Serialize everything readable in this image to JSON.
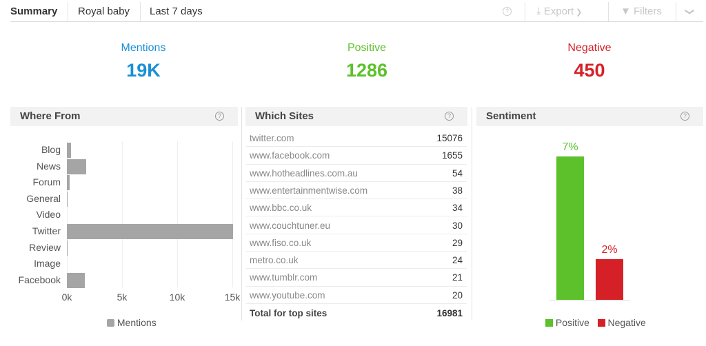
{
  "header": {
    "tabs": [
      "Summary",
      "Royal baby",
      "Last 7 days"
    ],
    "help_icon": "?",
    "export_label": "Export",
    "filters_label": "Filters"
  },
  "metrics": [
    {
      "label": "Mentions",
      "value": "19K",
      "color": "#1a8fd6"
    },
    {
      "label": "Positive",
      "value": "1286",
      "color": "#5cc12b"
    },
    {
      "label": "Negative",
      "value": "450",
      "color": "#d62027"
    }
  ],
  "panels": {
    "where_from": "Where From",
    "which_sites": "Which Sites",
    "sentiment": "Sentiment"
  },
  "chart_data": [
    {
      "type": "bar",
      "orientation": "horizontal",
      "categories": [
        "Blog",
        "News",
        "Forum",
        "General",
        "Video",
        "Twitter",
        "Review",
        "Image",
        "Facebook"
      ],
      "series": [
        {
          "name": "Mentions",
          "values": [
            370,
            1750,
            250,
            60,
            0,
            15076,
            10,
            0,
            1655
          ],
          "color": "#a5a5a5"
        }
      ],
      "xlim": [
        0,
        15000
      ],
      "xticks": [
        "0k",
        "5k",
        "10k",
        "15k"
      ],
      "grid": true,
      "legend": "bottom"
    },
    {
      "type": "bar",
      "categories": [
        "Positive",
        "Negative"
      ],
      "series": [
        {
          "name": "Positive",
          "values": [
            7
          ],
          "label": "7%",
          "color": "#5cc12b"
        },
        {
          "name": "Negative",
          "values": [
            2
          ],
          "label": "2%",
          "color": "#d62027"
        }
      ],
      "legend": "bottom"
    }
  ],
  "sites": {
    "rows": [
      {
        "site": "twitter.com",
        "count": "15076"
      },
      {
        "site": "www.facebook.com",
        "count": "1655"
      },
      {
        "site": "www.hotheadlines.com.au",
        "count": "54"
      },
      {
        "site": "www.entertainmentwise.com",
        "count": "38"
      },
      {
        "site": "www.bbc.co.uk",
        "count": "34"
      },
      {
        "site": "www.couchtuner.eu",
        "count": "30"
      },
      {
        "site": "www.fiso.co.uk",
        "count": "29"
      },
      {
        "site": "metro.co.uk",
        "count": "24"
      },
      {
        "site": "www.tumblr.com",
        "count": "21"
      },
      {
        "site": "www.youtube.com",
        "count": "20"
      }
    ],
    "total_label": "Total for top sites",
    "total": "16981"
  }
}
